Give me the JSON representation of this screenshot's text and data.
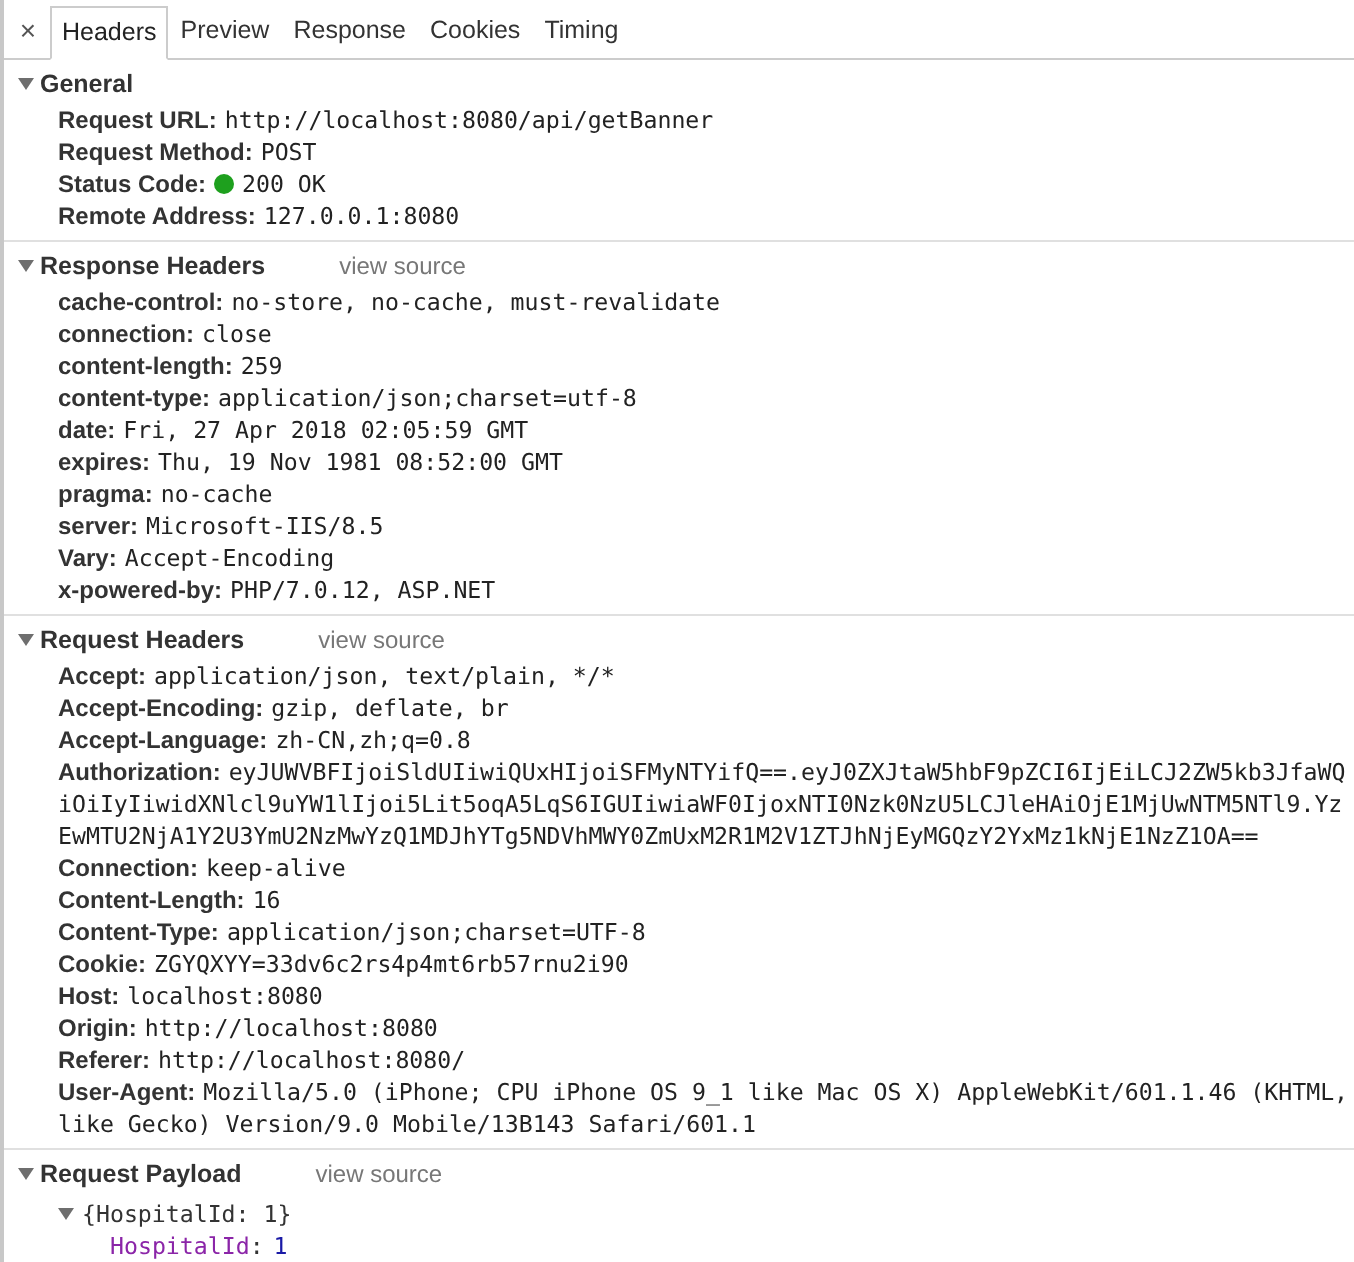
{
  "close_button": "×",
  "tabs": [
    {
      "label": "Headers",
      "selected": true
    },
    {
      "label": "Preview",
      "selected": false
    },
    {
      "label": "Response",
      "selected": false
    },
    {
      "label": "Cookies",
      "selected": false
    },
    {
      "label": "Timing",
      "selected": false
    }
  ],
  "sections": [
    {
      "kind": "headers",
      "title": "General",
      "expanded": true,
      "rows": [
        {
          "name": "Request URL:",
          "value": "http://localhost:8080/api/getBanner"
        },
        {
          "name": "Request Method:",
          "value": "POST"
        },
        {
          "name": "Status Code:",
          "value": "200 OK",
          "color": "#1ea01e"
        },
        {
          "name": "Remote Address:",
          "value": "127.0.0.1:8080"
        }
      ]
    },
    {
      "kind": "headers",
      "title": "Response Headers",
      "expanded": true,
      "link": "view source",
      "rows": [
        {
          "name": "cache-control:",
          "value": "no-store, no-cache, must-revalidate"
        },
        {
          "name": "connection:",
          "value": "close"
        },
        {
          "name": "content-length:",
          "value": "259"
        },
        {
          "name": "content-type:",
          "value": "application/json;charset=utf-8"
        },
        {
          "name": "date:",
          "value": "Fri, 27 Apr 2018 02:05:59 GMT"
        },
        {
          "name": "expires:",
          "value": "Thu, 19 Nov 1981 08:52:00 GMT"
        },
        {
          "name": "pragma:",
          "value": "no-cache"
        },
        {
          "name": "server:",
          "value": "Microsoft-IIS/8.5"
        },
        {
          "name": "Vary:",
          "value": "Accept-Encoding"
        },
        {
          "name": "x-powered-by:",
          "value": "PHP/7.0.12, ASP.NET"
        }
      ]
    },
    {
      "kind": "headers",
      "title": "Request Headers",
      "expanded": true,
      "link": "view source",
      "rows": [
        {
          "name": "Accept:",
          "value": "application/json, text/plain, */*"
        },
        {
          "name": "Accept-Encoding:",
          "value": "gzip, deflate, br"
        },
        {
          "name": "Accept-Language:",
          "value": "zh-CN,zh;q=0.8"
        },
        {
          "name": "Authorization:",
          "value": "eyJUWVBFIjoiSldUIiwiQUxHIjoiSFMyNTYifQ==.eyJ0ZXJtaW5hbF9pZCI6IjEiLCJ2ZW5kb3JfaWQiOiIyIiwidXNlcl9uYW1lIjoi5Lit5oqA5LqS6IGUIiwiaWF0IjoxNTI0Nzk0NzU5LCJleHAiOjE1MjUwNTM5NTl9.YzEwMTU2NjA1Y2U3YmU2NzMwYzQ1MDJhYTg5NDVhMWY0ZmUxM2R1M2V1ZTJhNjEyMGQzY2YxMz1kNjE1NzZ1OA=="
        },
        {
          "name": "Connection:",
          "value": "keep-alive"
        },
        {
          "name": "Content-Length:",
          "value": "16"
        },
        {
          "name": "Content-Type:",
          "value": "application/json;charset=UTF-8"
        },
        {
          "name": "Cookie:",
          "value": "ZGYQXYY=33dv6c2rs4p4mt6rb57rnu2i90"
        },
        {
          "name": "Host:",
          "value": "localhost:8080"
        },
        {
          "name": "Origin:",
          "value": "http://localhost:8080"
        },
        {
          "name": "Referer:",
          "value": "http://localhost:8080/"
        },
        {
          "name": "User-Agent:",
          "value": "Mozilla/5.0 (iPhone; CPU iPhone OS 9_1 like Mac OS X) AppleWebKit/601.1.46 (KHTML, like Gecko) Version/9.0 Mobile/13B143 Safari/601.1"
        }
      ]
    },
    {
      "kind": "tree",
      "title": "Request Payload",
      "expanded": true,
      "link": "view source",
      "tree": {
        "summary": "{HospitalId: 1}",
        "expanded": true,
        "children": [
          {
            "key": "HospitalId",
            "separator": ":",
            "value": "1"
          }
        ]
      }
    }
  ]
}
